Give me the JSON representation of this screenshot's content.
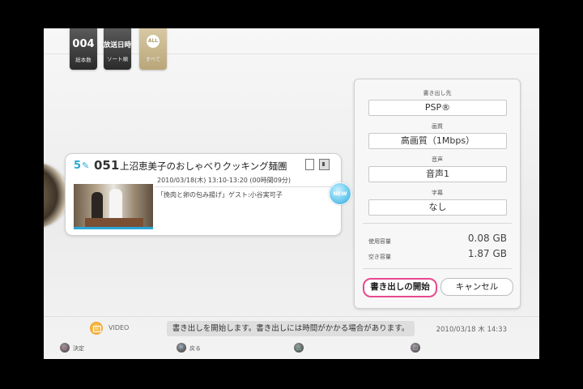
{
  "tabs": [
    {
      "value": "004",
      "label": "総本数"
    },
    {
      "value": "放送日時",
      "label": "ソート順"
    },
    {
      "value": "ALL",
      "label": "すべて"
    }
  ],
  "item": {
    "series_num": "5",
    "number": "051",
    "title": "上沼恵美子のおしゃべりクッキング麺團",
    "datetime": "2010/03/18(木) 13:10-13:20 (00時間09分)",
    "description": "「挽肉と卵の包み揚げ」ゲスト:小谷実可子",
    "badge": "NEW"
  },
  "panel": {
    "dest_label": "書き出し先",
    "dest_value": "PSP®",
    "quality_label": "画質",
    "quality_value": "高画質（1Mbps）",
    "audio_label": "音声",
    "audio_value": "音声1",
    "subtitle_label": "字幕",
    "subtitle_value": "なし",
    "used_label": "使用容量",
    "used_value": "0.08 GB",
    "free_label": "空き容量",
    "free_value": "1.87 GB",
    "start_label": "書き出しの開始",
    "cancel_label": "キャンセル"
  },
  "footer": {
    "app_label": "VIDEO",
    "message": "書き出しを開始します。書き出しには時間がかかる場合があります。",
    "clock": "2010/03/18 木 14:33",
    "confirm_label": "決定",
    "back_label": "戻る"
  },
  "colors": {
    "accent_blue": "#2aa6d9",
    "start_border": "#e8488f",
    "tab_gold": "#b9a679"
  }
}
